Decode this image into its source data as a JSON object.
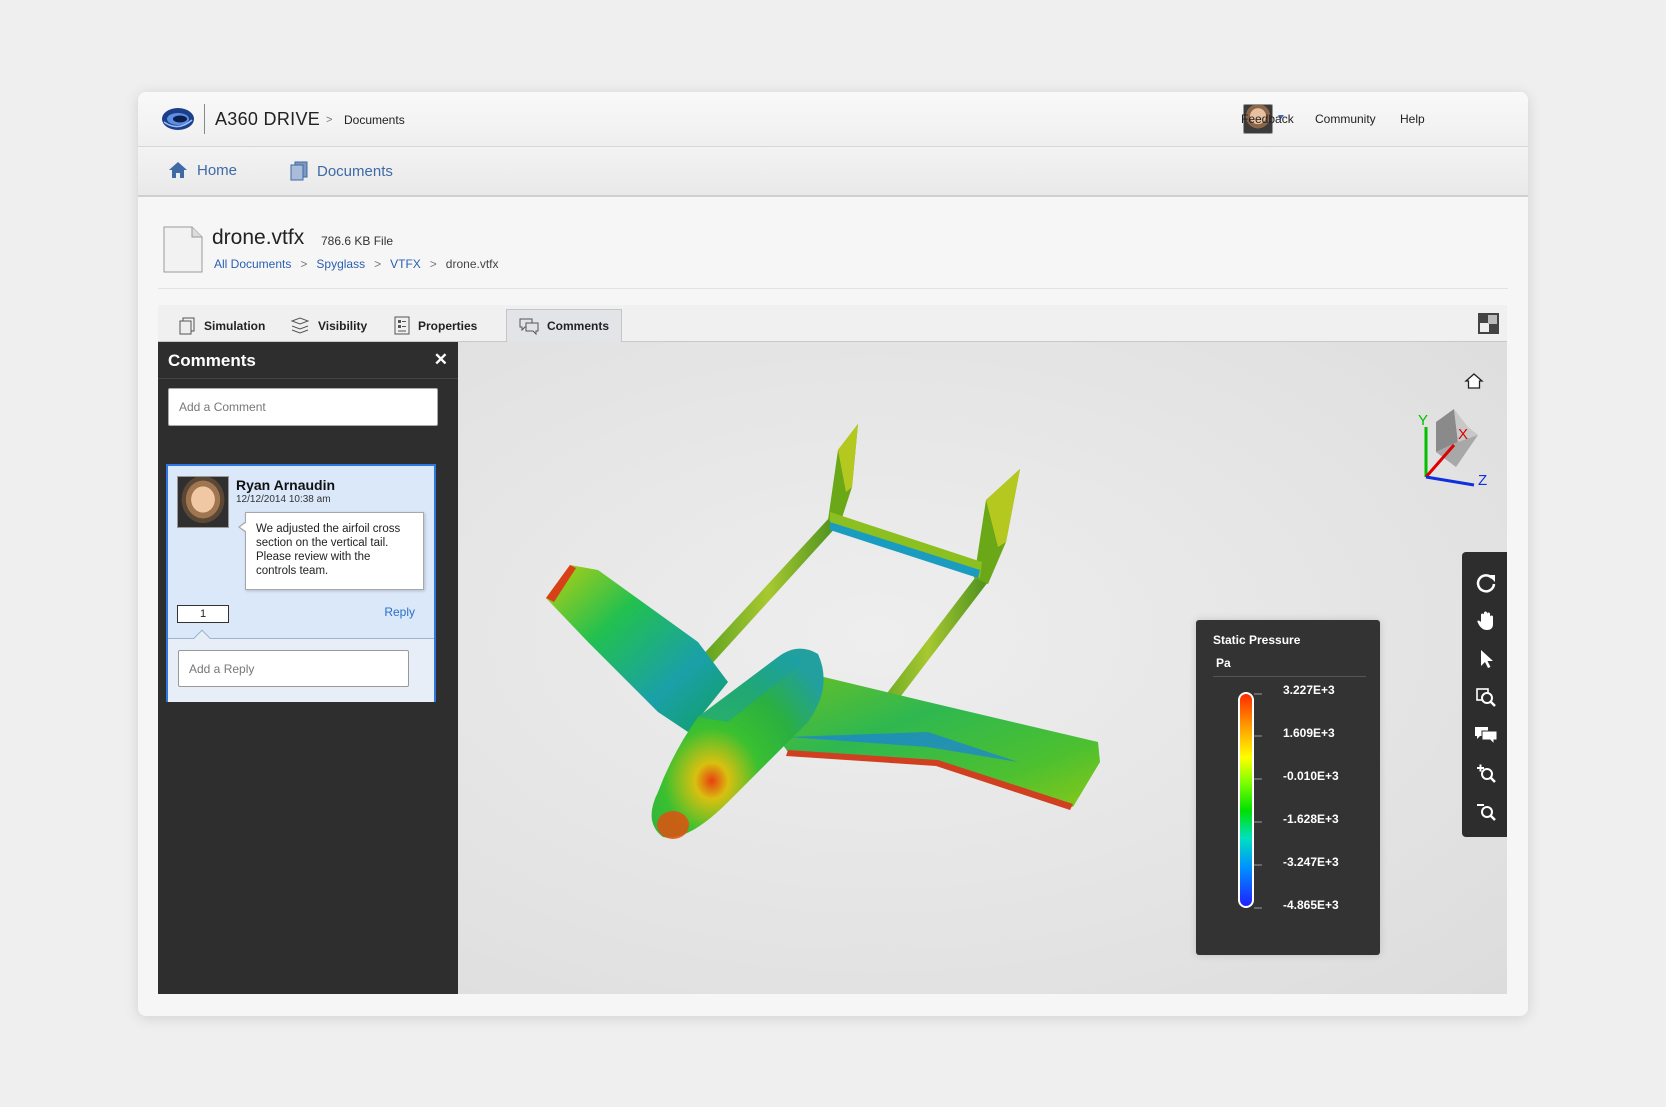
{
  "app": {
    "name": "A360 DRIVE",
    "crumb_sep": ">",
    "crumb_doc": "Documents"
  },
  "top_links": [
    "Feedback",
    "Community",
    "Help"
  ],
  "nav": {
    "home": "Home",
    "documents": "Documents"
  },
  "file": {
    "name": "drone.vtfx",
    "size": "786.6 KB File",
    "breadcrumb": [
      "All Documents",
      "Spyglass",
      "VTFX",
      "drone.vtfx"
    ],
    "breadcrumb_sep": ">"
  },
  "tabs": [
    "Simulation",
    "Visibility",
    "Properties",
    "Comments"
  ],
  "active_tab": "Comments",
  "comments_panel": {
    "title": "Comments",
    "close": "✕",
    "add_placeholder": "Add a Comment",
    "comment": {
      "author": "Ryan Arnaudin",
      "date": "12/12/2014 10:38 am",
      "text": "We adjusted the airfoil cross section on the vertical tail. Please review with the controls team.",
      "pin_number": "1",
      "reply_label": "Reply",
      "reply_placeholder": "Add a Reply"
    }
  },
  "viewcube": {
    "x_label": "X",
    "y_label": "Y",
    "z_label": "Z"
  },
  "toolbar_icons": [
    "orbit-icon",
    "pan-icon",
    "select-icon",
    "zoom-window-icon",
    "comments-icon",
    "zoom-in-icon",
    "zoom-out-icon"
  ],
  "legend": {
    "title": "Static Pressure",
    "unit": "Pa",
    "values": [
      "3.227E+3",
      "1.609E+3",
      "-0.010E+3",
      "-1.628E+3",
      "-3.247E+3",
      "-4.865E+3"
    ]
  },
  "colors": {
    "accent": "#2f77e0",
    "link": "#2a5fb0",
    "panel": "#2e2e2e",
    "nav_text": "#3e6aa5"
  }
}
